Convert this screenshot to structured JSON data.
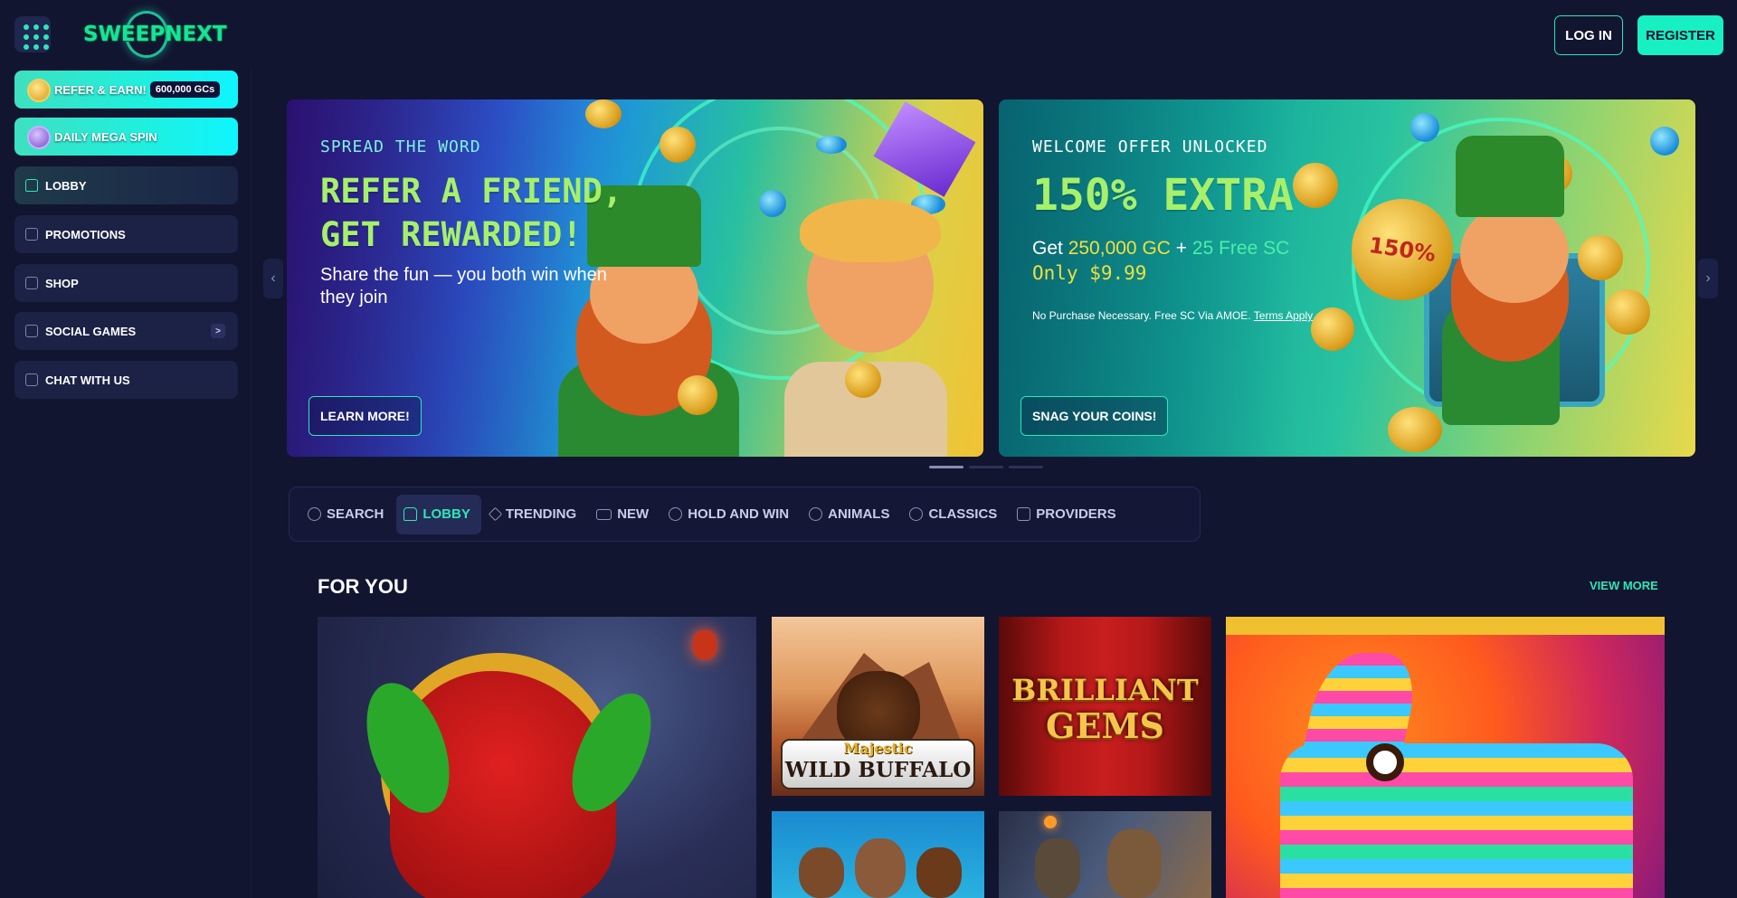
{
  "header": {
    "logo_text": "SWEEPNEXT",
    "login_label": "LOG IN",
    "register_label": "REGISTER"
  },
  "sidebar": {
    "refer_label": "REFER & EARN!",
    "refer_badge": "600,000 GCs",
    "spin_label": "DAILY MEGA SPIN",
    "items": [
      {
        "label": "LOBBY",
        "icon": "home-icon"
      },
      {
        "label": "PROMOTIONS",
        "icon": "gift-icon"
      },
      {
        "label": "SHOP",
        "icon": "shop-icon"
      },
      {
        "label": "SOCIAL GAMES",
        "icon": "dice-icon"
      },
      {
        "label": "CHAT WITH US",
        "icon": "chat-icon"
      }
    ]
  },
  "banners": [
    {
      "kicker": "SPREAD THE WORD",
      "title": "REFER A FRIEND, GET REWARDED!",
      "subtitle": "Share the fun — you both win when they join",
      "button": "LEARN MORE!"
    },
    {
      "kicker": "WELCOME OFFER UNLOCKED",
      "title": "150% EXTRA",
      "get": "Get",
      "gc": "250,000 GC",
      "plus": "+",
      "sc": "25 Free SC",
      "price": "Only $9.99",
      "disclaimer": "No Purchase Necessary. Free SC Via AMOE.",
      "terms": "Terms Apply",
      "coin_badge": "150%",
      "button": "SNAG YOUR COINS!"
    }
  ],
  "tabs": [
    {
      "label": "SEARCH",
      "icon": "search-icon"
    },
    {
      "label": "LOBBY",
      "icon": "home-icon"
    },
    {
      "label": "TRENDING",
      "icon": "diamond-icon"
    },
    {
      "label": "NEW",
      "icon": "new-icon"
    },
    {
      "label": "HOLD AND WIN",
      "icon": "gear-icon"
    },
    {
      "label": "ANIMALS",
      "icon": "paw-icon"
    },
    {
      "label": "CLASSICS",
      "icon": "chip-icon"
    },
    {
      "label": "PROVIDERS",
      "icon": "grid-icon"
    }
  ],
  "section": {
    "title": "FOR YOU",
    "view_more": "VIEW MORE"
  },
  "games": {
    "buffalo_top": "Majestic",
    "buffalo_bottom": "WILD BUFFALO",
    "gems_top": "BRILLIANT",
    "gems_bottom": "GEMS"
  },
  "colors": {
    "accent": "#2ee6b8",
    "background": "#121530",
    "panel": "#1c2146"
  }
}
